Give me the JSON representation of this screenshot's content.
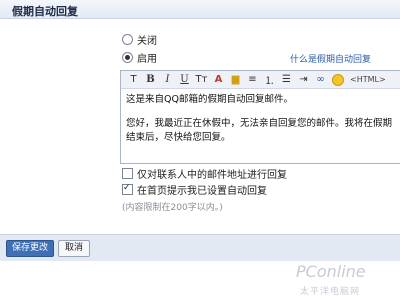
{
  "header": {
    "title": "假期自动回复"
  },
  "reply_mode": {
    "options": [
      {
        "label": "关闭",
        "selected": false
      },
      {
        "label": "启用",
        "selected": true
      }
    ],
    "help_link": "什么是假期自动回复"
  },
  "toolbar": {
    "buttons": [
      {
        "icon": "font-size-icon",
        "glyph": "T"
      },
      {
        "icon": "bold-icon",
        "glyph": "B"
      },
      {
        "icon": "italic-icon",
        "glyph": "I"
      },
      {
        "icon": "underline-icon",
        "glyph": "U"
      },
      {
        "icon": "font-icon",
        "glyph": "Tт"
      },
      {
        "icon": "text-color-icon",
        "glyph": "A"
      },
      {
        "icon": "highlight-icon",
        "glyph": "▆"
      },
      {
        "icon": "align-icon",
        "glyph": "≡"
      },
      {
        "icon": "numbered-list-icon",
        "glyph": "⒈"
      },
      {
        "icon": "bullet-list-icon",
        "glyph": "☰"
      },
      {
        "icon": "indent-icon",
        "glyph": "⇥"
      },
      {
        "icon": "link-icon",
        "glyph": "∞"
      }
    ],
    "html_label": "<HTML>"
  },
  "editor": {
    "paragraphs": [
      "这是来自QQ邮箱的假期自动回复邮件。",
      "您好，我最近正在休假中，无法亲自回复您的邮件。我将在假期结束后，尽快给您回复。"
    ]
  },
  "options": {
    "contacts_only": {
      "label": "仅对联系人中的邮件地址进行回复",
      "checked": false
    },
    "show_notice": {
      "label": "在首页提示我已设置自动回复",
      "checked": true
    }
  },
  "limit_note": "(内容限制在200字以内。)",
  "footer": {
    "save_label": "保存更改",
    "cancel_label": "取消"
  },
  "watermark": {
    "logo": "PConline",
    "sub": "太平洋电脑网"
  },
  "colors": {
    "accent": "#3f6fb5",
    "link": "#2a5ba8",
    "bar": "#e2e9f3"
  }
}
